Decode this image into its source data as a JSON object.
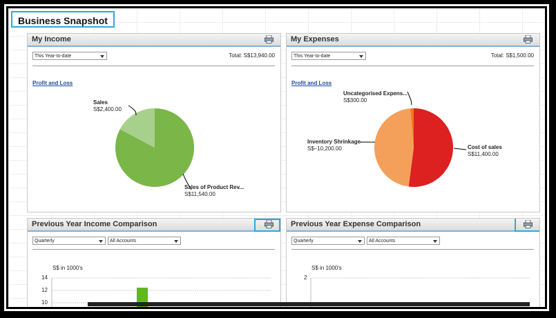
{
  "page": {
    "title": "Business Snapshot"
  },
  "income": {
    "title": "My Income",
    "period": "This Year-to-date",
    "total": "Total:  S$13,940.00",
    "link": "Profit and Loss",
    "slices": [
      {
        "name": "Sales",
        "value": "S$2,400.00",
        "amount": 2400,
        "color": "#a8d08d"
      },
      {
        "name": "Sales of Product Rev...",
        "value": "S$11,540.00",
        "amount": 11540,
        "color": "#7ab648"
      }
    ]
  },
  "expenses": {
    "title": "My Expenses",
    "period": "This Year-to-date",
    "total": "Total:  S$1,500.00",
    "link": "Profit and Loss",
    "slices": [
      {
        "name": "Uncategorised Expens...",
        "value": "S$300.00",
        "amount": 300,
        "color": "#f07a1a"
      },
      {
        "name": "Inventory Shrinkage",
        "value": "S$–10,200.00",
        "amount": 10200,
        "color": "#f4a05a"
      },
      {
        "name": "Cost of sales",
        "value": "S$11,400.00",
        "amount": 11400,
        "color": "#dd2020"
      }
    ]
  },
  "income_comparison": {
    "title": "Previous Year Income Comparison",
    "period": "Quarterly",
    "accounts": "All Accounts",
    "unit": "S$ in 1000's",
    "yticks": [
      "14",
      "12",
      "10"
    ],
    "bar_value": 12.5
  },
  "expense_comparison": {
    "title": "Previous Year Expense Comparison",
    "period": "Quarterly",
    "accounts": "All Accounts",
    "unit": "S$ in 1000's",
    "yticks": [
      "2"
    ]
  },
  "colors": {
    "accent": "#2aa9e0",
    "income_bar": "#5fb81c",
    "expense_bar": "#e07a30"
  }
}
